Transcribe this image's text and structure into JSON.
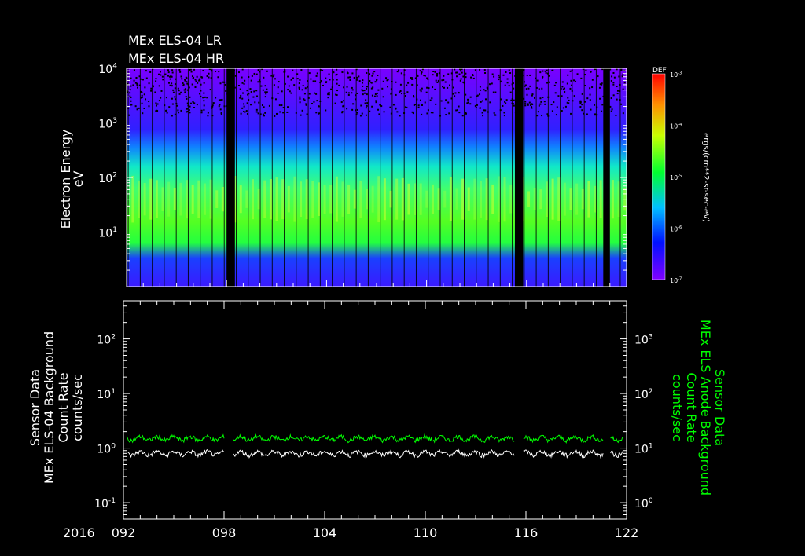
{
  "header": {
    "line1": "MEx ELS-04 LR",
    "line2": "MEx ELS-04 HR"
  },
  "colorbar": {
    "label": "DEF",
    "unit": "ergs/(cm**2-sr-sec-eV)",
    "ticks": [
      {
        "base": "10",
        "exp": "-3"
      },
      {
        "base": "10",
        "exp": "-4"
      },
      {
        "base": "10",
        "exp": "-5"
      },
      {
        "base": "10",
        "exp": "-6"
      },
      {
        "base": "10",
        "exp": "-7"
      }
    ],
    "colors": [
      "#7f00ff",
      "#0000ff",
      "#00c8ff",
      "#00ff00",
      "#ffff00",
      "#ff8000",
      "#ff0000"
    ]
  },
  "chart_data": [
    {
      "type": "heatmap",
      "ylabel": "Electron Energy",
      "yunit": "eV",
      "yscale": "log",
      "ylim": [
        1,
        10000
      ],
      "yticks": [
        {
          "base": "10",
          "exp": "1"
        },
        {
          "base": "10",
          "exp": "2"
        },
        {
          "base": "10",
          "exp": "3"
        },
        {
          "base": "10",
          "exp": "4"
        }
      ],
      "xlim": [
        92,
        122
      ],
      "data_gaps_doy": [
        [
          98.0,
          98.5
        ],
        [
          115.3,
          115.8
        ],
        [
          120.6,
          121.0
        ]
      ],
      "peak_band_eV": [
        8,
        300
      ]
    },
    {
      "type": "line",
      "ylabel_left": [
        "Sensor Data",
        "MEx ELS-04 Background",
        "Count Rate",
        "counts/sec"
      ],
      "ylabel_right": [
        "Sensor Data",
        "MEx ELS Anode Background",
        "Count Rate",
        "counts/sec"
      ],
      "yscale": "log",
      "ylim_left": [
        0.05,
        500
      ],
      "ylim_right": [
        0.5,
        5000
      ],
      "yticks_left": [
        {
          "base": "10",
          "exp": "-1"
        },
        {
          "base": "10",
          "exp": "0"
        },
        {
          "base": "10",
          "exp": "1"
        },
        {
          "base": "10",
          "exp": "2"
        }
      ],
      "yticks_right": [
        {
          "base": "10",
          "exp": "0"
        },
        {
          "base": "10",
          "exp": "1"
        },
        {
          "base": "10",
          "exp": "2"
        },
        {
          "base": "10",
          "exp": "3"
        }
      ],
      "series": [
        {
          "name": "MEx ELS-04 Background",
          "color": "#ffffff",
          "typical_value": 0.8
        },
        {
          "name": "MEx ELS Anode Background",
          "color": "#00ff00",
          "typical_value": 15
        }
      ]
    }
  ],
  "xaxis": {
    "year": "2016",
    "ticks": [
      "092",
      "098",
      "104",
      "110",
      "116",
      "122"
    ],
    "tick_values": [
      92,
      98,
      104,
      110,
      116,
      122
    ]
  }
}
